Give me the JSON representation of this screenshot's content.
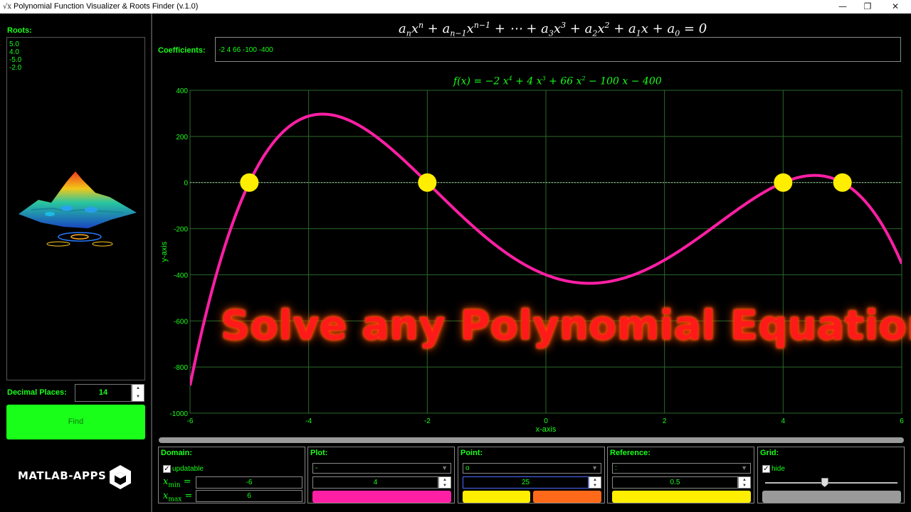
{
  "window": {
    "title": "Polynomial Function Visualizer & Roots Finder (v.1.0)",
    "app_icon": "matlab-icon",
    "controls": [
      "minimize-icon",
      "restore-icon",
      "close-icon"
    ]
  },
  "left_panel": {
    "roots_label": "Roots:",
    "roots": [
      "5.0",
      "4.0",
      "-5.0",
      "-2.0"
    ],
    "decimal_places_label": "Decimal Places:",
    "decimal_places": "14",
    "find_label": "Find",
    "brand": "MATLAB-APPS"
  },
  "main": {
    "equation_general": "a_n x^n + a_{n-1} x^{n-1} + ... + a_3 x^3 + a_2 x^2 + a_1 x + a_0 = 0",
    "coefficients_label": "Coefficients:",
    "coefficients_value": "-2 4 66 -100 -400",
    "overlay_text": "Solve any Polynomial Equation!"
  },
  "chart_data": {
    "type": "line",
    "title": "f(x) = −2 x^4 + 4 x^3 + 66 x^2 − 100 x − 400",
    "xlabel": "x-axis",
    "ylabel": "y-axis",
    "xlim": [
      -6,
      6
    ],
    "ylim": [
      -1000,
      400
    ],
    "xticks": [
      -6,
      -4,
      -2,
      0,
      2,
      4,
      6
    ],
    "yticks": [
      -1000,
      -800,
      -600,
      -400,
      -200,
      0,
      200,
      400
    ],
    "coefficients": [
      -2,
      4,
      66,
      -100,
      -400
    ],
    "roots": [
      -5,
      -2,
      4,
      5
    ],
    "reference_line_y": 0,
    "grid": true,
    "colors": {
      "curve": "#ff1fa5",
      "points": "#ffee00",
      "grid": "#2a6a2a",
      "axis_text": "#19ff19",
      "reference": "#dddddd"
    }
  },
  "bottom": {
    "domain": {
      "title": "Domain:",
      "updatable_label": "updatable",
      "updatable_checked": true,
      "xmin_label": "x",
      "xmin_sub": "min",
      "xmax_label": "x",
      "xmax_sub": "max",
      "xmin": "-6",
      "xmax": "6"
    },
    "plot": {
      "title": "Plot:",
      "line_style": "-",
      "line_width": "4",
      "color": "#ff1fa5"
    },
    "point": {
      "title": "Point:",
      "marker": "o",
      "size": "25",
      "color1": "#ffee00",
      "color2": "#ff6a1a"
    },
    "reference": {
      "title": "Reference:",
      "line_style": ":",
      "line_width": "0.5",
      "color": "#ffee00"
    },
    "grid": {
      "title": "Grid:",
      "hide_label": "hide",
      "hide_checked": true,
      "slider_value": 0.45
    }
  }
}
